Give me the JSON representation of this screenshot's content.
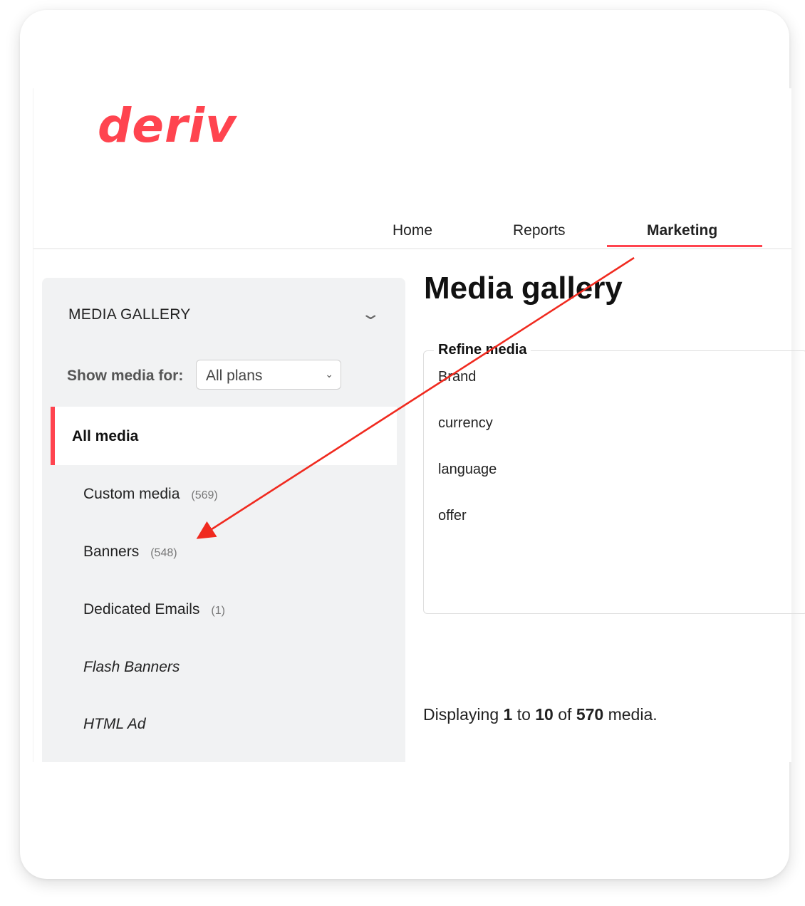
{
  "brand": {
    "logo_text": "deriv",
    "accent_color": "#ff444f"
  },
  "nav": {
    "items": [
      "Home",
      "Reports",
      "Marketing"
    ],
    "active": "Marketing"
  },
  "sidebar": {
    "title": "MEDIA GALLERY",
    "collapse_icon": "chevron-down-icon",
    "show_media_label": "Show media for:",
    "plan_select_value": "All plans",
    "active_item": "All media",
    "items": [
      {
        "label": "Custom media",
        "count": "(569)"
      },
      {
        "label": "Banners",
        "count": "(548)"
      },
      {
        "label": "Dedicated Emails",
        "count": "(1)"
      },
      {
        "label": "Flash Banners",
        "count": ""
      },
      {
        "label": "HTML Ad",
        "count": ""
      }
    ]
  },
  "main": {
    "title": "Media gallery",
    "refine": {
      "legend": "Refine media",
      "filters": [
        "Brand",
        "currency",
        "language",
        "offer"
      ]
    },
    "displaying": {
      "prefix": "Displaying",
      "from": "1",
      "to_word": "to",
      "to": "10",
      "of_word": "of",
      "total": "570",
      "suffix": "media."
    }
  },
  "annotation": {
    "color": "#f02a1f"
  }
}
